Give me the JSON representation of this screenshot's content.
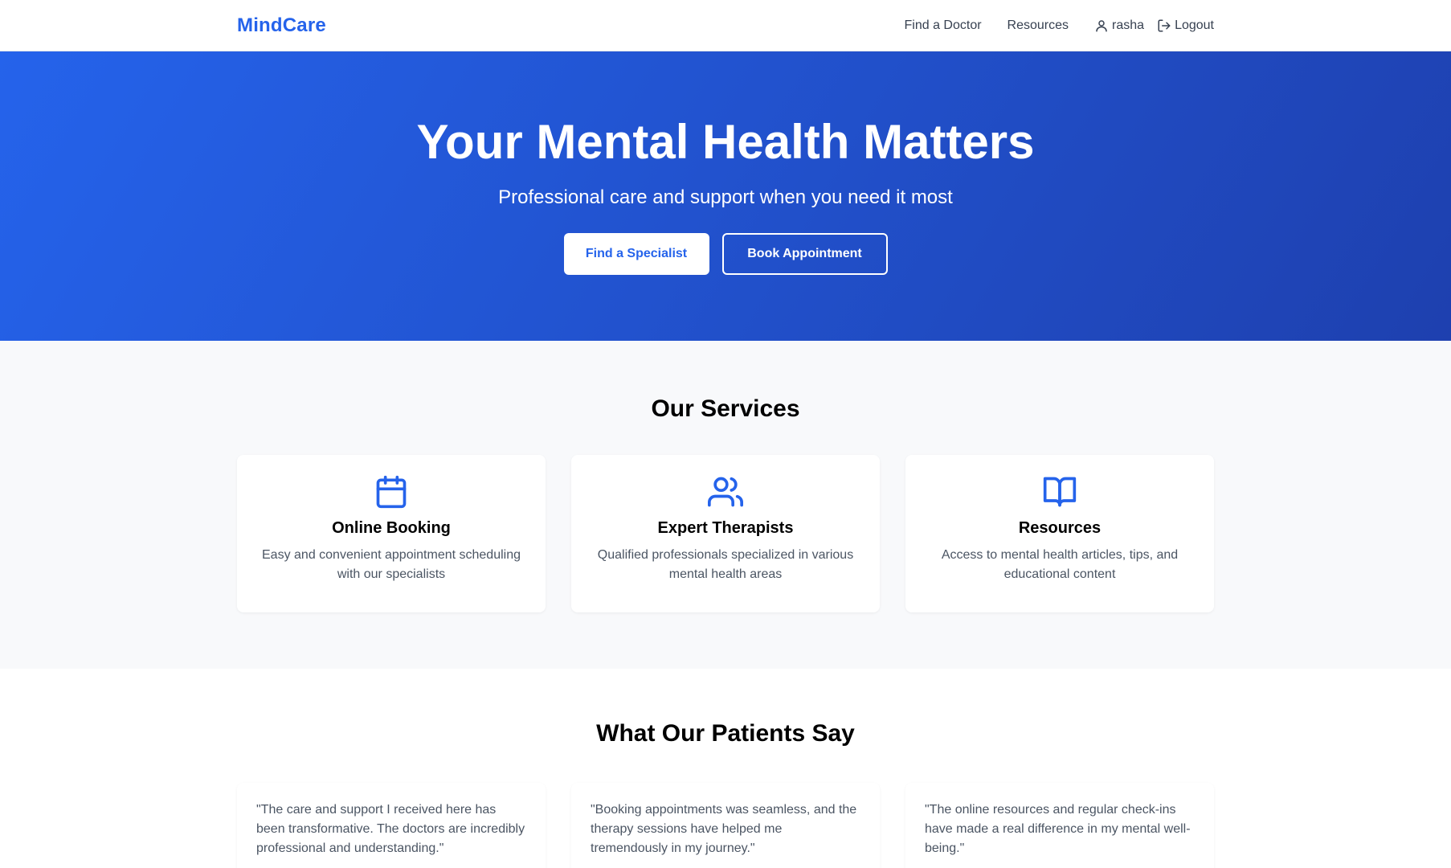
{
  "header": {
    "logo": "MindCare",
    "nav": {
      "find_doctor": "Find a Doctor",
      "resources": "Resources",
      "username": "rasha",
      "logout": "Logout"
    }
  },
  "hero": {
    "title": "Your Mental Health Matters",
    "subtitle": "Professional care and support when you need it most",
    "primary_button": "Find a Specialist",
    "secondary_button": "Book Appointment"
  },
  "services": {
    "title": "Our Services",
    "items": [
      {
        "icon": "calendar-icon",
        "title": "Online Booking",
        "description": "Easy and convenient appointment scheduling with our specialists"
      },
      {
        "icon": "users-icon",
        "title": "Expert Therapists",
        "description": "Qualified professionals specialized in various mental health areas"
      },
      {
        "icon": "book-open-icon",
        "title": "Resources",
        "description": "Access to mental health articles, tips, and educational content"
      }
    ]
  },
  "testimonials": {
    "title": "What Our Patients Say",
    "items": [
      {
        "quote": "\"The care and support I received here has been transformative. The doctors are incredibly professional and understanding.\""
      },
      {
        "quote": "\"Booking appointments was seamless, and the therapy sessions have helped me tremendously in my journey.\""
      },
      {
        "quote": "\"The online resources and regular check-ins have made a real difference in my mental well-being.\""
      }
    ]
  },
  "colors": {
    "brand": "#2563eb",
    "hero_gradient_start": "#2563eb",
    "hero_gradient_end": "#1e40af",
    "services_background": "#f8f9fb"
  }
}
